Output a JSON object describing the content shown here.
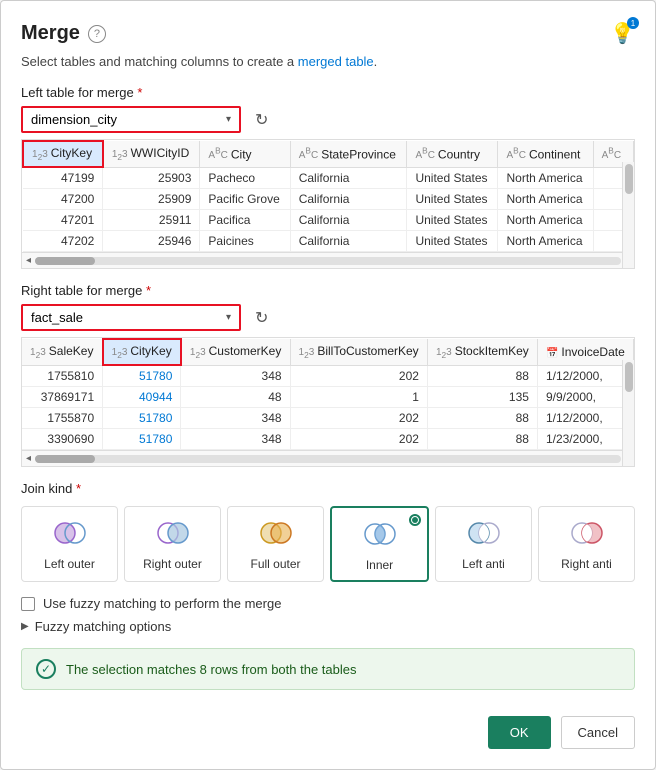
{
  "dialog": {
    "title": "Merge",
    "subtitle_text": "Select tables and matching columns to create a",
    "subtitle_link": "merged table",
    "subtitle_period": "."
  },
  "left_table": {
    "label": "Left table for merge",
    "required": "*",
    "selected": "dimension_city",
    "columns": [
      {
        "type": "123",
        "name": "CityKey",
        "selected": true
      },
      {
        "type": "123",
        "name": "WWICityID"
      },
      {
        "type": "ABC",
        "name": "City"
      },
      {
        "type": "ABC",
        "name": "StateProvince"
      },
      {
        "type": "ABC",
        "name": "Country"
      },
      {
        "type": "ABC",
        "name": "Continent"
      },
      {
        "type": "ABC",
        "name": "..."
      }
    ],
    "rows": [
      {
        "CityKey": "47199",
        "WWICityID": "25903",
        "City": "Pacheco",
        "StateProvince": "California",
        "Country": "United States",
        "Continent": "North America"
      },
      {
        "CityKey": "47200",
        "WWICityID": "25909",
        "City": "Pacific Grove",
        "StateProvince": "California",
        "Country": "United States",
        "Continent": "North America"
      },
      {
        "CityKey": "47201",
        "WWICityID": "25911",
        "City": "Pacifica",
        "StateProvince": "California",
        "Country": "United States",
        "Continent": "North America"
      },
      {
        "CityKey": "47202",
        "WWICityID": "25946",
        "City": "Paicines",
        "StateProvince": "California",
        "Country": "United States",
        "Continent": "North America"
      }
    ]
  },
  "right_table": {
    "label": "Right table for merge",
    "required": "*",
    "selected": "fact_sale",
    "columns": [
      {
        "type": "123",
        "name": "SaleKey"
      },
      {
        "type": "123",
        "name": "CityKey",
        "selected": true
      },
      {
        "type": "123",
        "name": "CustomerKey"
      },
      {
        "type": "123",
        "name": "BillToCustomerKey"
      },
      {
        "type": "123",
        "name": "StockItemKey"
      },
      {
        "type": "cal",
        "name": "InvoiceDate"
      }
    ],
    "rows": [
      {
        "SaleKey": "1755810",
        "CityKey": "51780",
        "CustomerKey": "348",
        "BillToCustomerKey": "202",
        "StockItemKey": "88",
        "InvoiceDate": "1/12/2000,"
      },
      {
        "SaleKey": "37869171",
        "CityKey": "40944",
        "CustomerKey": "48",
        "BillToCustomerKey": "1",
        "StockItemKey": "135",
        "InvoiceDate": "9/9/2000,"
      },
      {
        "SaleKey": "1755870",
        "CityKey": "51780",
        "CustomerKey": "348",
        "BillToCustomerKey": "202",
        "StockItemKey": "88",
        "InvoiceDate": "1/12/2000,"
      },
      {
        "SaleKey": "3390690",
        "CityKey": "51780",
        "CustomerKey": "348",
        "BillToCustomerKey": "202",
        "StockItemKey": "88",
        "InvoiceDate": "1/23/2000,"
      }
    ]
  },
  "join_section": {
    "label": "Join kind",
    "required": "*",
    "options": [
      {
        "id": "left-outer",
        "label": "Left outer",
        "selected": false
      },
      {
        "id": "right-outer",
        "label": "Right outer",
        "selected": false
      },
      {
        "id": "full-outer",
        "label": "Full outer",
        "selected": false
      },
      {
        "id": "inner",
        "label": "Inner",
        "selected": true
      },
      {
        "id": "left-anti",
        "label": "Left anti",
        "selected": false
      },
      {
        "id": "right-anti",
        "label": "Right anti",
        "selected": false
      }
    ]
  },
  "fuzzy": {
    "checkbox_label": "Use fuzzy matching to perform the merge",
    "expand_label": "Fuzzy matching options"
  },
  "success": {
    "message": "The selection matches 8 rows from both the tables"
  },
  "footer": {
    "ok_label": "OK",
    "cancel_label": "Cancel"
  }
}
